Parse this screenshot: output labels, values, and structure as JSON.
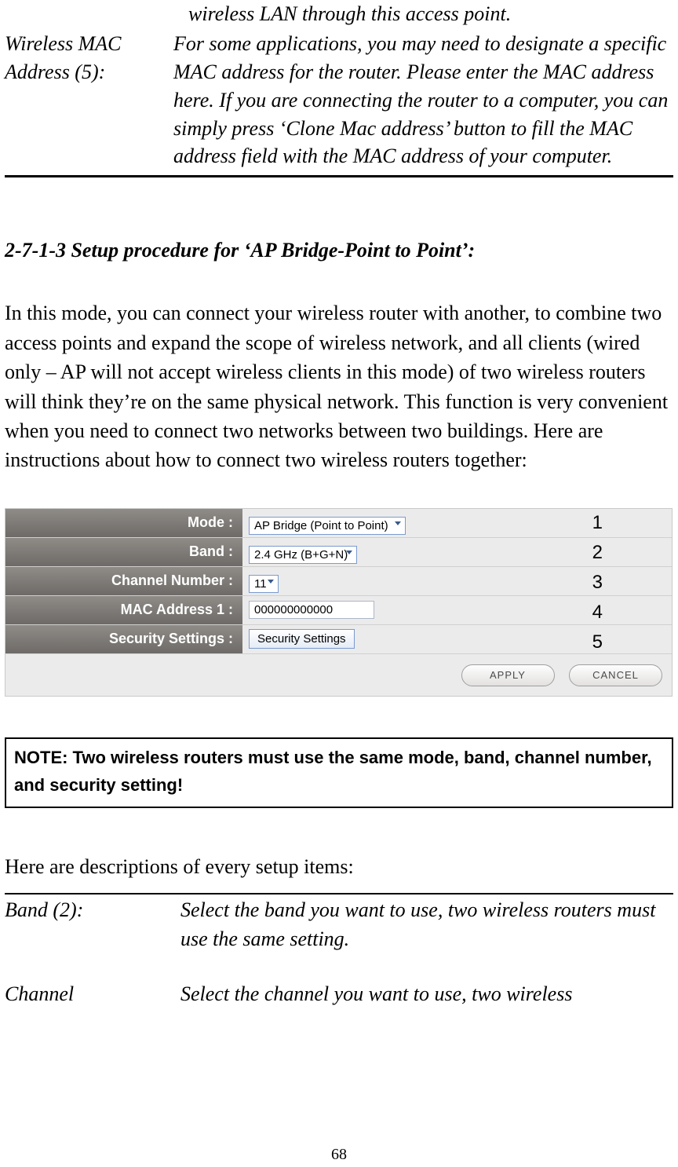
{
  "fragments": {
    "wlan_through_ap": "wireless LAN through this access point.",
    "wireless_mac_label": "Wireless MAC Address (5):",
    "wireless_mac_desc": "For some applications, you may need to designate a specific MAC address for the router. Please enter the MAC address here. If you are connecting the router to a computer, you can simply press ‘Clone Mac address’ button to fill the MAC address field with the MAC address of your computer."
  },
  "section_title": "2-7-1-3 Setup procedure for ‘AP Bridge-Point to Point’:",
  "intro_para": "In this mode, you can connect your wireless router with another, to combine two access points and expand the scope of wireless network, and all clients (wired only – AP will not accept wireless clients in this mode) of two wireless routers will think they’re on the same physical network. This function is very convenient when you need to connect two networks between two buildings. Here are instructions about how to connect two wireless routers together:",
  "config_panel": {
    "rows": {
      "mode": {
        "label": "Mode :",
        "value": "AP Bridge (Point to Point)"
      },
      "band": {
        "label": "Band :",
        "value": "2.4 GHz (B+G+N)"
      },
      "channel": {
        "label": "Channel Number :",
        "value": "11"
      },
      "mac1": {
        "label": "MAC Address 1 :",
        "value": "000000000000"
      },
      "security": {
        "label": "Security Settings :",
        "button": "Security Settings"
      }
    },
    "callouts": {
      "n1": "1",
      "n2": "2",
      "n3": "3",
      "n4": "4",
      "n5": "5"
    },
    "actions": {
      "apply": "APPLY",
      "cancel": "CANCEL"
    }
  },
  "note_box": "NOTE: Two wireless routers must use the same mode, band, channel number, and security setting!",
  "desc_intro": "Here are descriptions of every setup items:",
  "desc_rows": {
    "band": {
      "label": "Band (2):",
      "text": "Select the band you want to use, two wireless routers must use the same setting."
    },
    "channel": {
      "label": "Channel",
      "text": "Select the channel you want to use, two wireless"
    }
  },
  "page_number": "68"
}
